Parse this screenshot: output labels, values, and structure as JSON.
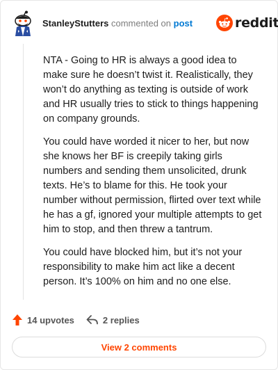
{
  "comment": {
    "username": "StanleyStutters",
    "verb": "commented on",
    "post_link": "post",
    "brand": "reddit",
    "paragraphs": [
      "NTA - Going to HR is always a good idea to make sure he doesn’t twist it. Realistically, they won’t do anything as texting is outside of work and HR usually tries to stick to things happening on company grounds.",
      "You could have worded it nicer to her, but now she knows her BF is creepily taking girls numbers and sending them unsolicited, drunk texts. He’s to blame for this. He took your number without permission, flirted over text while he has a gf, ignored your multiple attempts to get him to stop, and then threw a tantrum.",
      "You could have blocked him, but it’s not your responsibility to make him act like a decent person. It’s 100% on him and no one else."
    ],
    "upvotes": "14 upvotes",
    "replies": "2 replies",
    "view_comments": "View 2 comments"
  },
  "colors": {
    "brand_orange": "#ff4500",
    "link_blue": "#0079d3"
  },
  "icons": {
    "avatar": "snoo-avatar",
    "logo": "reddit-snoo-logo",
    "upvote": "upvote-arrow-icon",
    "reply": "reply-arrow-icon"
  }
}
